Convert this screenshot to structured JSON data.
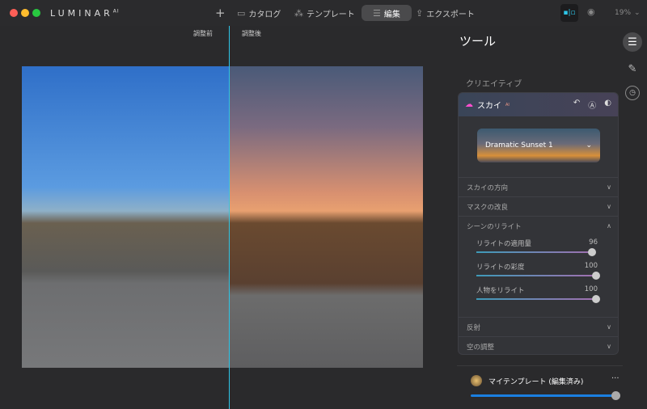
{
  "app": {
    "title": "LUMINAR",
    "title_sup": "AI"
  },
  "toolbar": {
    "add": "+",
    "catalog": "カタログ",
    "templates": "テンプレート",
    "edit": "編集",
    "export": "エクスポート",
    "zoom": "19%",
    "zoom_chevron": "⌄"
  },
  "canvas": {
    "before": "調整前",
    "after": "調整後"
  },
  "panel": {
    "title": "ツール",
    "section": "クリエイティブ",
    "sky": {
      "name": "スカイ",
      "sup": "AI",
      "preset": "Dramatic Sunset 1",
      "rows": {
        "direction": "スカイの方向",
        "mask": "マスクの改良",
        "relight": "シーンのリライト",
        "reflection": "反射",
        "sky_adjust": "空の調整"
      },
      "sliders": [
        {
          "label": "リライトの適用量",
          "value": 96
        },
        {
          "label": "リライトの彩度",
          "value": 100
        },
        {
          "label": "人物をリライト",
          "value": 100
        }
      ]
    }
  },
  "template": {
    "name": "マイテンプレート (編集済み)",
    "more": "···",
    "amount": 100
  },
  "colors": {
    "accent": "#2ec6e8",
    "sky": "#ff4fcf",
    "template_slider": "#1a7fe0"
  }
}
